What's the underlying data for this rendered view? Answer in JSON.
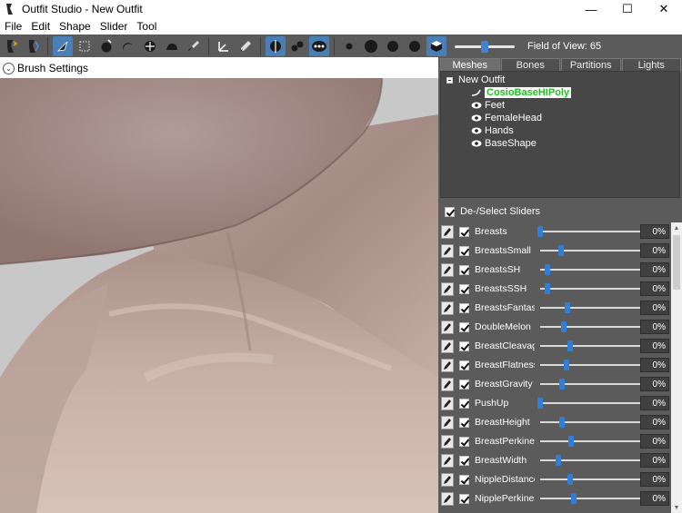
{
  "window": {
    "title": "Outfit Studio - New Outfit",
    "minimize": "—",
    "maximize": "☐",
    "close": "✕"
  },
  "menu": [
    "File",
    "Edit",
    "Shape",
    "Slider",
    "Tool"
  ],
  "toolbar": {
    "fov_label": "Field of View: 65",
    "fov_value": 0.5
  },
  "brush": {
    "label": "Brush Settings"
  },
  "tabs": [
    {
      "label": "Meshes",
      "active": true
    },
    {
      "label": "Bones",
      "active": false
    },
    {
      "label": "Partitions",
      "active": false
    },
    {
      "label": "Lights",
      "active": false
    }
  ],
  "tree": {
    "root": "New Outfit",
    "children": [
      {
        "label": "CosioBaseHIPoly",
        "selected": true,
        "icon": "bone-curve-icon"
      },
      {
        "label": "Feet",
        "selected": false,
        "icon": "eye-icon"
      },
      {
        "label": "FemaleHead",
        "selected": false,
        "icon": "eye-icon"
      },
      {
        "label": "Hands",
        "selected": false,
        "icon": "eye-icon"
      },
      {
        "label": "BaseShape",
        "selected": false,
        "icon": "eye-icon"
      }
    ]
  },
  "sliders_header": "De-/Select Sliders",
  "sliders": [
    {
      "name": "Breasts",
      "value": "0%",
      "pos": 0.0
    },
    {
      "name": "BreastsSmall",
      "value": "0%",
      "pos": 0.18
    },
    {
      "name": "BreastsSH",
      "value": "0%",
      "pos": 0.06
    },
    {
      "name": "BreastsSSH",
      "value": "0%",
      "pos": 0.06
    },
    {
      "name": "BreastsFantasy",
      "value": "0%",
      "pos": 0.24
    },
    {
      "name": "DoubleMelon",
      "value": "0%",
      "pos": 0.21
    },
    {
      "name": "BreastCleavage",
      "value": "0%",
      "pos": 0.26
    },
    {
      "name": "BreastFlatness",
      "value": "0%",
      "pos": 0.23
    },
    {
      "name": "BreastGravity",
      "value": "0%",
      "pos": 0.19
    },
    {
      "name": "PushUp",
      "value": "0%",
      "pos": 0.0
    },
    {
      "name": "BreastHeight",
      "value": "0%",
      "pos": 0.19
    },
    {
      "name": "BreastPerkiness",
      "value": "0%",
      "pos": 0.27
    },
    {
      "name": "BreastWidth",
      "value": "0%",
      "pos": 0.16
    },
    {
      "name": "NippleDistance",
      "value": "0%",
      "pos": 0.26
    },
    {
      "name": "NipplePerkiness",
      "value": "0%",
      "pos": 0.29
    }
  ],
  "colors": {
    "toolbar": "#5b5b5b",
    "panel": "#5b5b5b",
    "accent": "#2f7fd6",
    "selected_mesh": "#20c020"
  }
}
